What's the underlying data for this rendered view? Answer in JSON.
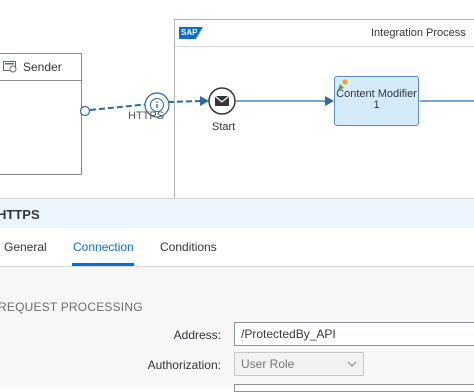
{
  "canvas": {
    "sender_label": "Sender",
    "process_title": "Integration Process",
    "sap_logo_text": "SAP",
    "http_label": "HTTPS",
    "start_label": "Start",
    "content_modifier_label": "Content Modifier\n1",
    "colors": {
      "connector": "#2c6aa0",
      "task_fill": "#d6ebfa",
      "accent": "#0a6ed1"
    }
  },
  "panel": {
    "title": "HTTPS",
    "tabs": [
      {
        "label": "General",
        "active": false
      },
      {
        "label": "Connection",
        "active": true
      },
      {
        "label": "Conditions",
        "active": false
      }
    ],
    "section_title": "REQUEST PROCESSING",
    "fields": {
      "address_label": "Address:",
      "address_value": "/ProtectedBy_API",
      "authorization_label": "Authorization:",
      "authorization_value": "User Role"
    }
  }
}
